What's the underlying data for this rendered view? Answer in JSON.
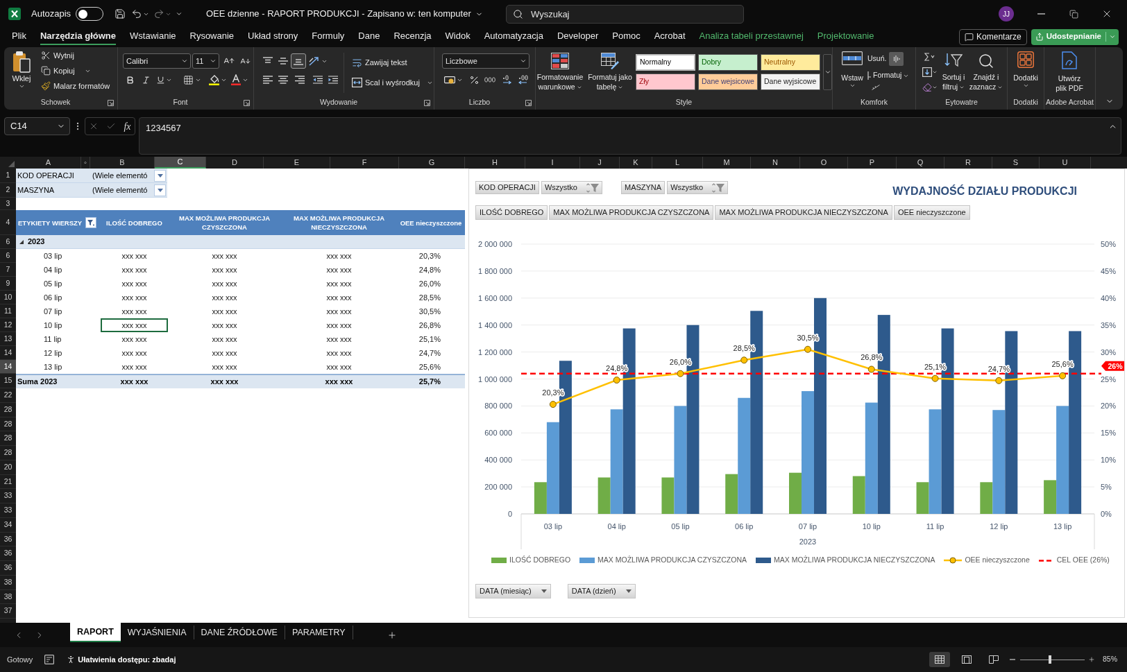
{
  "title_bar": {
    "autosave": {
      "label": "Autozapis",
      "on": false
    },
    "document_title": "OEE dzienne - RAPORT PRODUKCJI - Zapisano w: ten komputer",
    "search": {
      "placeholder": "Wyszukaj"
    },
    "avatar": "JJ"
  },
  "menu": {
    "tabs": [
      {
        "label": "Plik",
        "selected": false,
        "contextual": false
      },
      {
        "label": "Narzędzia główne",
        "selected": true,
        "contextual": false
      },
      {
        "label": "Wstawianie",
        "selected": false,
        "contextual": false
      },
      {
        "label": "Rysowanie",
        "selected": false,
        "contextual": false
      },
      {
        "label": "Układ strony",
        "selected": false,
        "contextual": false
      },
      {
        "label": "Formuly",
        "selected": false,
        "contextual": false
      },
      {
        "label": "Dane",
        "selected": false,
        "contextual": false
      },
      {
        "label": "Recenzja",
        "selected": false,
        "contextual": false
      },
      {
        "label": "Widok",
        "selected": false,
        "contextual": false
      },
      {
        "label": "Automatyzacja",
        "selected": false,
        "contextual": false
      },
      {
        "label": "Developer",
        "selected": false,
        "contextual": false
      },
      {
        "label": "Pomoc",
        "selected": false,
        "contextual": false
      },
      {
        "label": "Acrobat",
        "selected": false,
        "contextual": false
      },
      {
        "label": "Analiza tabeli przestawnej",
        "selected": false,
        "contextual": true
      },
      {
        "label": "Projektowanie",
        "selected": false,
        "contextual": true
      }
    ],
    "comments": "Komentarze",
    "share": "Udostepnianie"
  },
  "ribbon": {
    "clipboard": {
      "label": "Schowek",
      "paste": "Wklej",
      "cut": "Wytnij",
      "copy": "Kopiuj",
      "format_painter": "Malarz formatów"
    },
    "font": {
      "label": "Font",
      "name": "Calibri",
      "size": "11"
    },
    "alignment": {
      "label": "Wydowanie",
      "vertical": [
        {
          "selected": false
        },
        {
          "selected": false
        },
        {
          "selected": true
        }
      ],
      "wrap_text": "Zawijaj tekst",
      "merge": "Scal i wyśrodkuj"
    },
    "number": {
      "label": "Liczbo",
      "format": "Liczbowe"
    },
    "styles": {
      "label": "Style",
      "conditional_formatting": "Formatowanie warunkowe",
      "format_as_table": "Formatuj jako tabelę",
      "gallery": [
        {
          "label": "Normalny",
          "kind": "normal",
          "selected": true
        },
        {
          "label": "Dobry",
          "kind": "good",
          "selected": false
        },
        {
          "label": "Neutralny",
          "kind": "neutral",
          "selected": false
        },
        {
          "label": "Zły",
          "kind": "bad",
          "selected": false
        },
        {
          "label": "Dane wejsicowe",
          "kind": "input",
          "selected": false
        },
        {
          "label": "Dane wyjsicowe",
          "kind": "output",
          "selected": false
        }
      ]
    },
    "cells": {
      "label": "Komfork",
      "insert": "Wstaw",
      "delete": "Usuń.",
      "format": "Formatuj"
    },
    "editing": {
      "label": "Eytowatre",
      "sort_filter": "Sortuj i filtruj",
      "find_select": "Znajdź i zaznacz"
    },
    "add_ins": {
      "label": "Dodatki",
      "button": "Dodatki"
    },
    "acrobat": {
      "label": "Adobe Acrobat",
      "button": "Utwórz plik PDF"
    }
  },
  "formula_bar": {
    "name_box": "C14",
    "function_symbol": "fx",
    "formula": "1234567"
  },
  "sheet": {
    "columns": [
      {
        "label": "A",
        "selected": false
      },
      {
        "label": "◦",
        "selected": false
      },
      {
        "label": "B",
        "selected": false
      },
      {
        "label": "C",
        "selected": true
      },
      {
        "label": "D",
        "selected": false
      },
      {
        "label": "E",
        "selected": false
      },
      {
        "label": "F",
        "selected": false
      },
      {
        "label": "G",
        "selected": false
      },
      {
        "label": "H",
        "selected": false
      },
      {
        "label": "I",
        "selected": false
      },
      {
        "label": "J",
        "selected": false
      },
      {
        "label": "K",
        "selected": false
      },
      {
        "label": "L",
        "selected": false
      },
      {
        "label": "M",
        "selected": false
      },
      {
        "label": "N",
        "selected": false
      },
      {
        "label": "O",
        "selected": false
      },
      {
        "label": "P",
        "selected": false
      },
      {
        "label": "Q",
        "selected": false
      },
      {
        "label": "R",
        "selected": false
      },
      {
        "label": "S",
        "selected": false
      },
      {
        "label": "U",
        "selected": false
      }
    ],
    "report_filters": [
      {
        "row": {
          "label": "1",
          "selected": false
        },
        "label": "KOD OPERACJI",
        "value": "(Wiele elementó"
      },
      {
        "row": {
          "label": "2",
          "selected": false
        },
        "label": "MASZYNA",
        "value": "(Wiele elementó"
      }
    ],
    "blank_row": {
      "label": "3",
      "selected": false
    },
    "pivot": {
      "header": {
        "row": {
          "label": "4",
          "selected": false
        },
        "cells": [
          "ETYKIETY WIERSZY",
          "ILOŚĆ DOBREGO",
          "MAX MOŻLIWA PRODUKCJA CZYSZCZONA",
          "MAX MOŻLIWA PRODUKCJA NIECZYSZCZONA",
          "OEE nieczyszczone"
        ]
      },
      "group": {
        "row": {
          "label": "6",
          "selected": false
        },
        "label": "2023",
        "expanded": true
      },
      "rows": [
        {
          "row": {
            "label": "6",
            "selected": false
          },
          "cells": [
            "03 lip",
            "xxx xxx",
            "xxx xxx",
            "xxx xxx",
            "20,3%"
          ],
          "current": false
        },
        {
          "row": {
            "label": "7",
            "selected": false
          },
          "cells": [
            "04 lip",
            "xxx xxx",
            "xxx xxx",
            "xxx xxx",
            "24,8%"
          ],
          "current": false
        },
        {
          "row": {
            "label": "9",
            "selected": false
          },
          "cells": [
            "05 lip",
            "xxx xxx",
            "xxx xxx",
            "xxx xxx",
            "26,0%"
          ],
          "current": false
        },
        {
          "row": {
            "label": "10",
            "selected": false
          },
          "cells": [
            "06 lip",
            "xxx xxx",
            "xxx xxx",
            "xxx xxx",
            "28,5%"
          ],
          "current": false
        },
        {
          "row": {
            "label": "11",
            "selected": false
          },
          "cells": [
            "07 lip",
            "xxx xxx",
            "xxx xxx",
            "xxx xxx",
            "30,5%"
          ],
          "current": false
        },
        {
          "row": {
            "label": "12",
            "selected": false
          },
          "cells": [
            "10 lip",
            "xxx xxx",
            "xxx xxx",
            "xxx xxx",
            "26,8%"
          ],
          "current": true
        },
        {
          "row": {
            "label": "13",
            "selected": false
          },
          "cells": [
            "11 lip",
            "xxx xxx",
            "xxx xxx",
            "xxx xxx",
            "25,1%"
          ],
          "current": false
        },
        {
          "row": {
            "label": "14",
            "selected": false
          },
          "cells": [
            "12 lip",
            "xxx xxx",
            "xxx xxx",
            "xxx xxx",
            "24,7%"
          ],
          "current": false
        },
        {
          "row": {
            "label": "14",
            "selected": true
          },
          "cells": [
            "13 lip",
            "xxx xxx",
            "xxx xxx",
            "xxx xxx",
            "25,6%"
          ],
          "current": false
        }
      ],
      "total": {
        "row": {
          "label": "15",
          "selected": false
        },
        "cells": [
          "Suma 2023",
          "xxx xxx",
          "xxx xxx",
          "xxx xxx",
          "25,7%"
        ]
      }
    },
    "empty_rows": [
      {
        "label": "22",
        "selected": false
      },
      {
        "label": "28",
        "selected": false
      },
      {
        "label": "28",
        "selected": false
      },
      {
        "label": "28",
        "selected": false
      },
      {
        "label": "28",
        "selected": false
      },
      {
        "label": "20",
        "selected": false
      },
      {
        "label": "21",
        "selected": false
      },
      {
        "label": "33",
        "selected": false
      },
      {
        "label": "33",
        "selected": false
      },
      {
        "label": "34",
        "selected": false
      },
      {
        "label": "36",
        "selected": false
      },
      {
        "label": "36",
        "selected": false
      },
      {
        "label": "36",
        "selected": false
      },
      {
        "label": "38",
        "selected": false
      },
      {
        "label": "38",
        "selected": false
      },
      {
        "label": "37",
        "selected": false
      }
    ],
    "chart": {
      "field_buttons": [
        {
          "label": "KOD OPERACJI",
          "value": "Wszystko"
        },
        {
          "label": "MASZYNA",
          "value": "Wszystko"
        }
      ],
      "value_buttons": [
        "ILOŚĆ DOBREGO",
        "MAX MOŻLIWA PRODUKCJA CZYSZCZONA",
        "MAX MOŻLIWA PRODUKCJA NIECZYSZCZONA",
        "OEE nieczyszczone"
      ],
      "axis_buttons": [
        "DATA (miesiąc)",
        "DATA (dzień)"
      ],
      "chart_data": {
        "type": "bar",
        "title": "WYDAJNOŚĆ DZIAŁU PRODUKCJI",
        "xlabel": "2023",
        "categories": [
          "03 lip",
          "04 lip",
          "05 lip",
          "06 lip",
          "07 lip",
          "10 lip",
          "11 lip",
          "12 lip",
          "13 lip"
        ],
        "series": [
          {
            "name": "ILOŚĆ DOBREGO",
            "color": "#70ad47",
            "values": [
              235000,
              270000,
              270000,
              295000,
              305000,
              280000,
              235000,
              235000,
              250000
            ]
          },
          {
            "name": "MAX MOŻLIWA PRODUKCJA CZYSZCZONA",
            "color": "#5b9bd5",
            "values": [
              680000,
              775000,
              800000,
              860000,
              910000,
              825000,
              775000,
              770000,
              800000
            ]
          },
          {
            "name": "MAX MOŻLIWA PRODUKCJA NIECZYSZCZONA",
            "color": "#2e5a8c",
            "values": [
              1135000,
              1375000,
              1400000,
              1505000,
              1600000,
              1475000,
              1375000,
              1355000,
              1355000
            ]
          },
          {
            "name": "OEE nieczyszczone",
            "type": "line",
            "axis": "y2",
            "color": "#ffc000",
            "marker": "o",
            "values": [
              0.203,
              0.248,
              0.26,
              0.285,
              0.305,
              0.268,
              0.251,
              0.247,
              0.256
            ],
            "value_labels": [
              "20,3%",
              "24,8%",
              "26,0%",
              "28,5%",
              "30,5%",
              "26,8%",
              "25,1%",
              "24,7%",
              "25,6%"
            ]
          }
        ],
        "ref_lines": [
          {
            "axis": "y2",
            "value": 0.26,
            "color": "#ff0000",
            "label": "CEL OEE (26%)"
          }
        ],
        "annotations": [
          "26%"
        ],
        "grid": true,
        "legend": true,
        "ylim": [
          0,
          2000000
        ],
        "yticks": [
          {
            "value": 0,
            "label": "0"
          },
          {
            "value": 200000,
            "label": "200 000"
          },
          {
            "value": 400000,
            "label": "400 000"
          },
          {
            "value": 600000,
            "label": "600 000"
          },
          {
            "value": 800000,
            "label": "800 000"
          },
          {
            "value": 1000000,
            "label": "1 000 000"
          },
          {
            "value": 1200000,
            "label": "1 200 000"
          },
          {
            "value": 1400000,
            "label": "1 400 000"
          },
          {
            "value": 1600000,
            "label": "1 600 000"
          },
          {
            "value": 1800000,
            "label": "1 800 000"
          },
          {
            "value": 2000000,
            "label": "2 000 000"
          }
        ],
        "y2lim": [
          0,
          0.5
        ],
        "y2ticks": [
          {
            "value": 0,
            "label": "0%"
          },
          {
            "value": 0.05,
            "label": "5%"
          },
          {
            "value": 0.1,
            "label": "10%"
          },
          {
            "value": 0.15,
            "label": "15%"
          },
          {
            "value": 0.2,
            "label": "20%"
          },
          {
            "value": 0.25,
            "label": "25%"
          },
          {
            "value": 0.3,
            "label": "30%"
          },
          {
            "value": 0.35,
            "label": "35%"
          },
          {
            "value": 0.4,
            "label": "40%"
          },
          {
            "value": 0.45,
            "label": "45%"
          },
          {
            "value": 0.5,
            "label": "50%"
          }
        ]
      }
    }
  },
  "sheet_tabs": [
    {
      "label": "RAPORT",
      "selected": true
    },
    {
      "label": "WYJAŚNIENIA",
      "selected": false
    },
    {
      "label": "DANE ŹRÓDŁOWE",
      "selected": false
    },
    {
      "label": "PARAMETRY",
      "selected": false
    }
  ],
  "status_bar": {
    "status": "Gotowy",
    "accessibility": "Ułatwienia dostępu: zbadaj",
    "views": [
      {
        "selected": true
      },
      {
        "selected": false
      },
      {
        "selected": false
      }
    ],
    "zoom": {
      "level": 0.46,
      "reading": "85%"
    }
  }
}
